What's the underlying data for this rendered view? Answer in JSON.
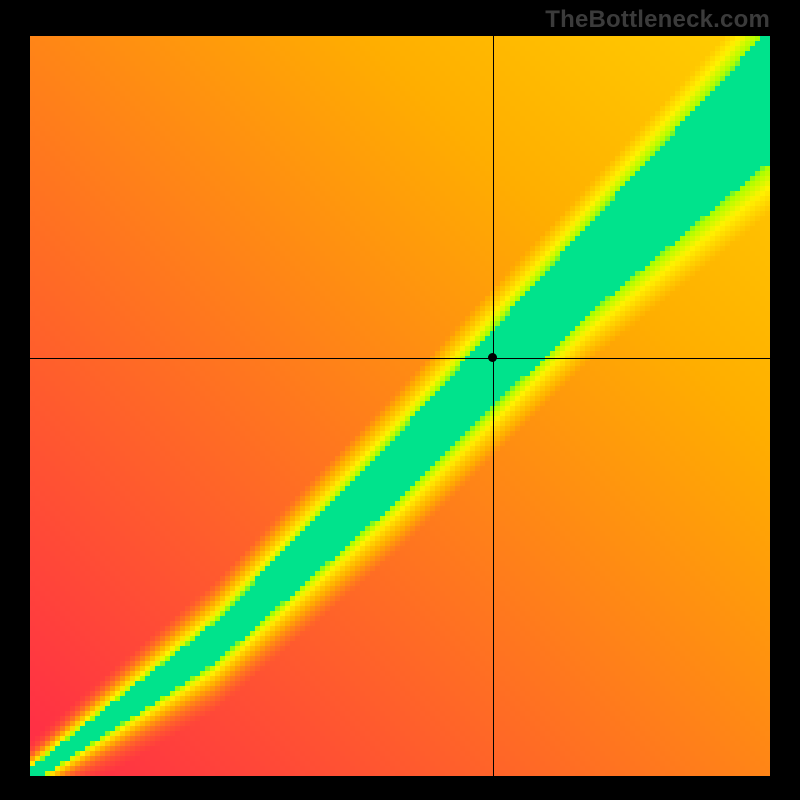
{
  "watermark": "TheBottleneck.com",
  "chart_data": {
    "type": "heatmap",
    "title": "",
    "xlabel": "",
    "ylabel": "",
    "x_range": [
      0,
      1
    ],
    "y_range": [
      0,
      1
    ],
    "grid": false,
    "legend": false,
    "color_stops": [
      {
        "t": 0.0,
        "hex": "#ff2a48"
      },
      {
        "t": 0.4,
        "hex": "#ffae00"
      },
      {
        "t": 0.7,
        "hex": "#fff200"
      },
      {
        "t": 0.9,
        "hex": "#a8ff00"
      },
      {
        "t": 1.0,
        "hex": "#00e38c"
      }
    ],
    "ridge": {
      "control_points": [
        {
          "x": 0.0,
          "y": 0.0,
          "half_width": 0.01
        },
        {
          "x": 0.25,
          "y": 0.18,
          "half_width": 0.028
        },
        {
          "x": 0.5,
          "y": 0.42,
          "half_width": 0.045
        },
        {
          "x": 0.75,
          "y": 0.68,
          "half_width": 0.06
        },
        {
          "x": 1.0,
          "y": 0.92,
          "half_width": 0.09
        }
      ],
      "yellow_band_scale": 2.2,
      "falloff_exponent": 1.15
    },
    "crosshair": {
      "x": 0.625,
      "y": 0.565
    },
    "marker": {
      "x": 0.625,
      "y": 0.565
    },
    "pixel_resolution": 148
  }
}
